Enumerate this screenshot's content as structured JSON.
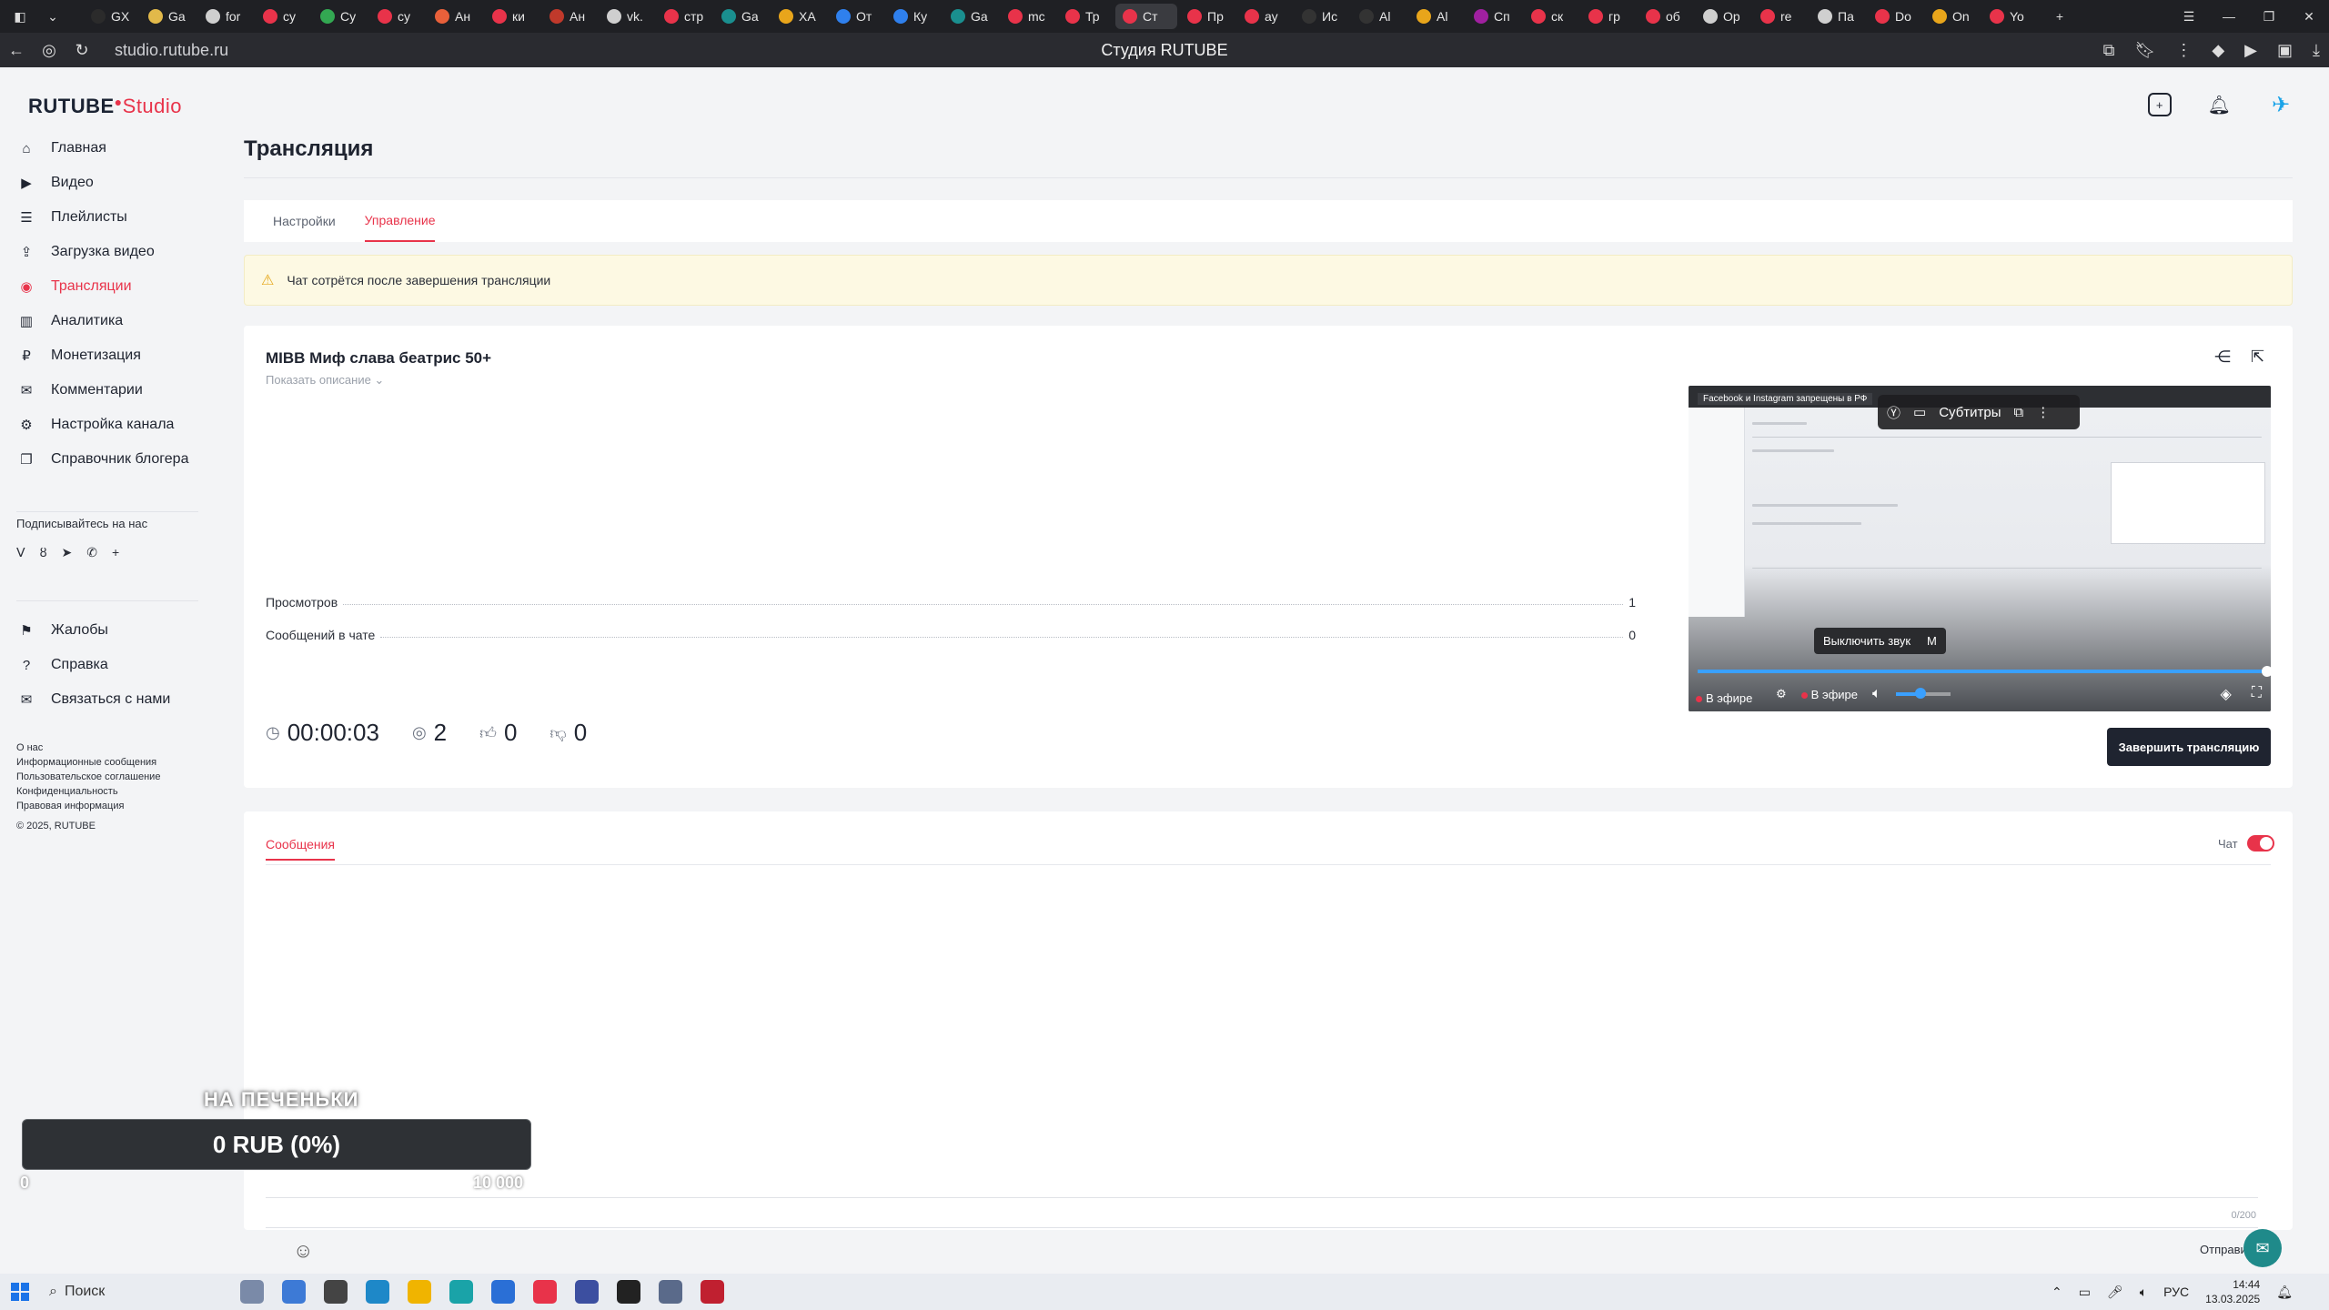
{
  "browser": {
    "tabs": [
      {
        "label": "GX",
        "color": "#2b2b2b"
      },
      {
        "label": "Ga",
        "color": "#e2b94a"
      },
      {
        "label": "for",
        "color": "#cfcfcf"
      },
      {
        "label": "су",
        "color": "#e8334a"
      },
      {
        "label": "Су",
        "color": "#33a852"
      },
      {
        "label": "су",
        "color": "#e8334a"
      },
      {
        "label": "Ан",
        "color": "#e8603a"
      },
      {
        "label": "ки",
        "color": "#e8334a"
      },
      {
        "label": "Ан",
        "color": "#c0392b"
      },
      {
        "label": "vk.",
        "color": "#cfcfcf"
      },
      {
        "label": "стр",
        "color": "#e8334a"
      },
      {
        "label": "Ga",
        "color": "#1a8f8f"
      },
      {
        "label": "ХА",
        "color": "#e8a51b"
      },
      {
        "label": "От",
        "color": "#2f80ed"
      },
      {
        "label": "Ку",
        "color": "#2f80ed"
      },
      {
        "label": "Ga",
        "color": "#1a8f8f"
      },
      {
        "label": "mc",
        "color": "#e8334a"
      },
      {
        "label": "Тр",
        "color": "#e8334a"
      },
      {
        "label": "Ст",
        "color": "#e8334a",
        "active": true
      },
      {
        "label": "Пр",
        "color": "#e8334a"
      },
      {
        "label": "ау",
        "color": "#e8334a"
      },
      {
        "label": "Ис",
        "color": "#333333"
      },
      {
        "label": "Al",
        "color": "#333333"
      },
      {
        "label": "Al",
        "color": "#e8a51b"
      },
      {
        "label": "Сп",
        "color": "#a020a0"
      },
      {
        "label": "ск",
        "color": "#e8334a"
      },
      {
        "label": "гр",
        "color": "#e8334a"
      },
      {
        "label": "об",
        "color": "#e8334a"
      },
      {
        "label": "Ор",
        "color": "#cfcfcf"
      },
      {
        "label": "re",
        "color": "#e8334a"
      },
      {
        "label": "Па",
        "color": "#cfcfcf"
      },
      {
        "label": "Do",
        "color": "#e8334a"
      },
      {
        "label": "On",
        "color": "#e8a51b"
      },
      {
        "label": "Yo",
        "color": "#e8334a"
      }
    ],
    "url": "studio.rutube.ru",
    "page_title": "Студия RUTUBE"
  },
  "logo": {
    "main": "RUTUBE",
    "sub": "Studio"
  },
  "sidebar": {
    "items": [
      {
        "label": "Главная",
        "icon": "home-icon",
        "glyph": "⌂"
      },
      {
        "label": "Видео",
        "icon": "video-icon",
        "glyph": "▶"
      },
      {
        "label": "Плейлисты",
        "icon": "playlist-icon",
        "glyph": "☰"
      },
      {
        "label": "Загрузка видео",
        "icon": "upload-icon",
        "glyph": "⇪"
      },
      {
        "label": "Трансляции",
        "icon": "broadcast-icon",
        "glyph": "◉",
        "active": true
      },
      {
        "label": "Аналитика",
        "icon": "analytics-icon",
        "glyph": "▥"
      },
      {
        "label": "Монетизация",
        "icon": "money-icon",
        "glyph": "₽"
      },
      {
        "label": "Комментарии",
        "icon": "comment-icon",
        "glyph": "✉"
      },
      {
        "label": "Настройка канала",
        "icon": "gear-icon",
        "glyph": "⚙"
      },
      {
        "label": "Справочник блогера",
        "icon": "book-icon",
        "glyph": "❐"
      }
    ],
    "subscribe_label": "Подписывайтесь на нас",
    "social_glyphs": [
      "vk",
      "ok",
      "tg",
      "wa",
      "+"
    ],
    "secondary": [
      {
        "label": "Жалобы",
        "icon": "flag-icon",
        "glyph": "⚑"
      },
      {
        "label": "Справка",
        "icon": "help-icon",
        "glyph": "?"
      },
      {
        "label": "Связаться с нами",
        "icon": "mail-icon",
        "glyph": "✉"
      }
    ],
    "footer_links": [
      "О нас",
      "Информационные сообщения",
      "Пользовательское соглашение",
      "Конфиденциальность",
      "Правовая информация"
    ],
    "copyright": "© 2025, RUTUBE"
  },
  "page": {
    "title": "Трансляция",
    "tabs": [
      {
        "label": "Настройки"
      },
      {
        "label": "Управление",
        "active": true
      }
    ],
    "notice": "Чат сотрётся после завершения трансляции"
  },
  "stream": {
    "title": "MIBB Миф слава беатрис 50+",
    "show_description": "Показать описание",
    "stats": [
      {
        "label": "Просмотров",
        "value": "1"
      },
      {
        "label": "Сообщений в чате",
        "value": "0"
      }
    ],
    "timer": "00:00:03",
    "viewers": "2",
    "likes": "0",
    "dislikes": "0",
    "end_button": "Завершить трансляцию"
  },
  "player": {
    "fb_note": "Facebook и Instagram запрещены в РФ",
    "subtitles_label": "Субтитры",
    "tooltip_label": "Выключить звук",
    "tooltip_key": "M",
    "live_label": "В эфире",
    "live_label_2": "В эфире",
    "progress_fraction": 1.0,
    "volume_fraction": 0.45
  },
  "chat": {
    "tab_label": "Сообщения",
    "toggle_label": "Чат",
    "toggle_on": true,
    "counter": "0/200",
    "send_label": "Отправить"
  },
  "donation": {
    "title": "НА ПЕЧЕНЬКИ",
    "amount": "0 RUB (0%)",
    "min": "0",
    "max": "10 000"
  },
  "taskbar": {
    "search_placeholder": "Поиск",
    "lang": "РУС",
    "time": "14:44",
    "date": "13.03.2025"
  }
}
